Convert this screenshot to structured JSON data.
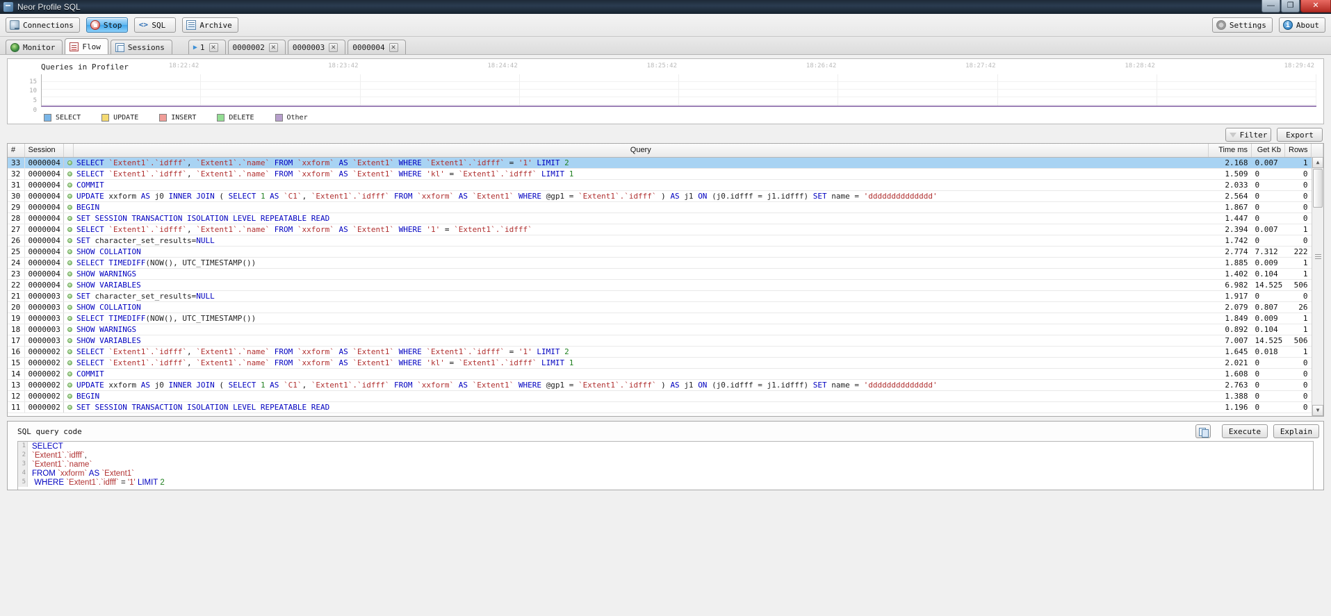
{
  "window": {
    "title": "Neor Profile SQL",
    "minimize": "—",
    "maximize": "❐",
    "close": "✕"
  },
  "toolbar": {
    "connections": "Connections",
    "stop": "Stop",
    "sql": "SQL",
    "archive": "Archive",
    "settings": "Settings",
    "about": "About",
    "icons": {
      "connections": "connections-icon",
      "stop": "stop-icon",
      "sql": "sql-icon",
      "archive": "archive-icon",
      "settings": "gear-icon",
      "about": "info-icon"
    }
  },
  "tabs": {
    "main": [
      {
        "label": "Monitor",
        "icon": "globe-icon",
        "selected": false
      },
      {
        "label": "Flow",
        "icon": "flow-icon",
        "selected": true
      },
      {
        "label": "Sessions",
        "icon": "sessions-icon",
        "selected": false
      }
    ],
    "sessions": [
      {
        "label": "1",
        "close": "✕",
        "play": "▶"
      },
      {
        "label": "0000002",
        "close": "✕"
      },
      {
        "label": "0000003",
        "close": "✕"
      },
      {
        "label": "0000004",
        "close": "✕"
      }
    ]
  },
  "chart_data": {
    "type": "area",
    "title": "Queries in Profiler",
    "xlabel": "",
    "ylabel": "",
    "ylim": [
      0,
      17
    ],
    "yticks": [
      15,
      10,
      5,
      0
    ],
    "grid": true,
    "legend_position": "bottom-left",
    "x": [
      "18:22:42",
      "18:23:42",
      "18:24:42",
      "18:25:42",
      "18:26:42",
      "18:27:42",
      "18:28:42",
      "18:29:42"
    ],
    "xticklabels": [
      "18:22:42",
      "18:23:42",
      "18:24:42",
      "18:25:42",
      "18:26:42",
      "18:27:42",
      "18:28:42",
      "18:29:42"
    ],
    "series": [
      {
        "name": "SELECT",
        "color": "#7ab6e8",
        "values": [
          0,
          0,
          0,
          0,
          0,
          0,
          0,
          0
        ]
      },
      {
        "name": "UPDATE",
        "color": "#f4da72",
        "values": [
          0,
          0,
          0,
          0,
          0,
          0,
          0,
          0
        ]
      },
      {
        "name": "INSERT",
        "color": "#f09d98",
        "values": [
          0,
          0,
          0,
          0,
          0,
          0,
          0,
          0
        ]
      },
      {
        "name": "DELETE",
        "color": "#93dd93",
        "values": [
          0,
          0,
          0,
          0,
          0,
          0,
          0,
          0
        ]
      },
      {
        "name": "Other",
        "color": "#b79fcc",
        "values": [
          0,
          0,
          0,
          0,
          0,
          0,
          0,
          0
        ]
      }
    ]
  },
  "filterbar": {
    "filter": "Filter",
    "export": "Export"
  },
  "table": {
    "headers": {
      "num": "#",
      "session": "Session",
      "query": "Query",
      "time": "Time ms",
      "kb": "Get Kb",
      "rows": "Rows"
    },
    "rows": [
      {
        "num": "33",
        "session": "0000004",
        "time": "2.168",
        "kb": "0.007",
        "rows": "1",
        "selected": true,
        "query": [
          [
            "kw",
            "SELECT "
          ],
          [
            "id",
            "`Extent1`.`idfff`"
          ],
          [
            "op",
            ", "
          ],
          [
            "id",
            "`Extent1`.`name`"
          ],
          [
            "kw",
            " FROM "
          ],
          [
            "id",
            "`xxform`"
          ],
          [
            "kw",
            " AS "
          ],
          [
            "id",
            "`Extent1`"
          ],
          [
            "kw",
            " WHERE "
          ],
          [
            "id",
            "`Extent1`.`idfff`"
          ],
          [
            "op",
            " = "
          ],
          [
            "id",
            "'1'"
          ],
          [
            "kw",
            " LIMIT "
          ],
          [
            "num",
            "2"
          ]
        ]
      },
      {
        "num": "32",
        "session": "0000004",
        "time": "1.509",
        "kb": "0",
        "rows": "0",
        "query": [
          [
            "kw",
            "SELECT "
          ],
          [
            "id",
            "`Extent1`.`idfff`"
          ],
          [
            "op",
            ", "
          ],
          [
            "id",
            "`Extent1`.`name`"
          ],
          [
            "kw",
            " FROM "
          ],
          [
            "id",
            "`xxform`"
          ],
          [
            "kw",
            " AS "
          ],
          [
            "id",
            "`Extent1`"
          ],
          [
            "kw",
            " WHERE "
          ],
          [
            "id",
            "'kl'"
          ],
          [
            "op",
            " = "
          ],
          [
            "id",
            "`Extent1`.`idfff`"
          ],
          [
            "kw",
            " LIMIT "
          ],
          [
            "num",
            "1"
          ]
        ]
      },
      {
        "num": "31",
        "session": "0000004",
        "time": "2.033",
        "kb": "0",
        "rows": "0",
        "query": [
          [
            "kw",
            "COMMIT"
          ]
        ]
      },
      {
        "num": "30",
        "session": "0000004",
        "time": "2.564",
        "kb": "0",
        "rows": "0",
        "query": [
          [
            "kw",
            "UPDATE "
          ],
          [
            "pl",
            "xxform "
          ],
          [
            "kw",
            "AS "
          ],
          [
            "pl",
            "j0 "
          ],
          [
            "kw",
            "INNER JOIN "
          ],
          [
            "op",
            "( "
          ],
          [
            "kw",
            "SELECT "
          ],
          [
            "num",
            "1"
          ],
          [
            "kw",
            " AS "
          ],
          [
            "id",
            "`C1`"
          ],
          [
            "op",
            ", "
          ],
          [
            "id",
            "`Extent1`.`idfff`"
          ],
          [
            "kw",
            " FROM "
          ],
          [
            "id",
            "`xxform`"
          ],
          [
            "kw",
            " AS "
          ],
          [
            "id",
            "`Extent1`"
          ],
          [
            "kw",
            " WHERE "
          ],
          [
            "pl",
            "@gp1 = "
          ],
          [
            "id",
            "`Extent1`.`idfff`"
          ],
          [
            "op",
            " ) "
          ],
          [
            "kw",
            "AS "
          ],
          [
            "pl",
            "j1 "
          ],
          [
            "kw",
            "ON "
          ],
          [
            "pl",
            "(j0.idfff = j1.idfff) "
          ],
          [
            "kw",
            "SET "
          ],
          [
            "pl",
            "name = "
          ],
          [
            "id",
            "'dddddddddddddd'"
          ]
        ]
      },
      {
        "num": "29",
        "session": "0000004",
        "time": "1.867",
        "kb": "0",
        "rows": "0",
        "query": [
          [
            "kw",
            "BEGIN"
          ]
        ]
      },
      {
        "num": "28",
        "session": "0000004",
        "time": "1.447",
        "kb": "0",
        "rows": "0",
        "query": [
          [
            "kw",
            "SET SESSION TRANSACTION ISOLATION LEVEL REPEATABLE READ"
          ]
        ]
      },
      {
        "num": "27",
        "session": "0000004",
        "time": "2.394",
        "kb": "0.007",
        "rows": "1",
        "query": [
          [
            "kw",
            "SELECT "
          ],
          [
            "id",
            "`Extent1`.`idfff`"
          ],
          [
            "op",
            ", "
          ],
          [
            "id",
            "`Extent1`.`name`"
          ],
          [
            "kw",
            " FROM "
          ],
          [
            "id",
            "`xxform`"
          ],
          [
            "kw",
            " AS "
          ],
          [
            "id",
            "`Extent1`"
          ],
          [
            "kw",
            " WHERE "
          ],
          [
            "id",
            "'1'"
          ],
          [
            "op",
            " = "
          ],
          [
            "id",
            "`Extent1`.`idfff`"
          ]
        ]
      },
      {
        "num": "26",
        "session": "0000004",
        "time": "1.742",
        "kb": "0",
        "rows": "0",
        "query": [
          [
            "kw",
            "SET "
          ],
          [
            "pl",
            "character_set_results="
          ],
          [
            "kw",
            "NULL"
          ]
        ]
      },
      {
        "num": "25",
        "session": "0000004",
        "time": "2.774",
        "kb": "7.312",
        "rows": "222",
        "query": [
          [
            "kw",
            "SHOW COLLATION"
          ]
        ]
      },
      {
        "num": "24",
        "session": "0000004",
        "time": "1.885",
        "kb": "0.009",
        "rows": "1",
        "query": [
          [
            "kw",
            "SELECT TIMEDIFF"
          ],
          [
            "pl",
            "(NOW(), UTC_TIMESTAMP())"
          ]
        ]
      },
      {
        "num": "23",
        "session": "0000004",
        "time": "1.402",
        "kb": "0.104",
        "rows": "1",
        "query": [
          [
            "kw",
            "SHOW WARNINGS"
          ]
        ]
      },
      {
        "num": "22",
        "session": "0000004",
        "time": "6.982",
        "kb": "14.525",
        "rows": "506",
        "query": [
          [
            "kw",
            "SHOW VARIABLES"
          ]
        ]
      },
      {
        "num": "21",
        "session": "0000003",
        "time": "1.917",
        "kb": "0",
        "rows": "0",
        "query": [
          [
            "kw",
            "SET "
          ],
          [
            "pl",
            "character_set_results="
          ],
          [
            "kw",
            "NULL"
          ]
        ]
      },
      {
        "num": "20",
        "session": "0000003",
        "time": "2.079",
        "kb": "0.807",
        "rows": "26",
        "query": [
          [
            "kw",
            "SHOW COLLATION"
          ]
        ]
      },
      {
        "num": "19",
        "session": "0000003",
        "time": "1.849",
        "kb": "0.009",
        "rows": "1",
        "query": [
          [
            "kw",
            "SELECT TIMEDIFF"
          ],
          [
            "pl",
            "(NOW(), UTC_TIMESTAMP())"
          ]
        ]
      },
      {
        "num": "18",
        "session": "0000003",
        "time": "0.892",
        "kb": "0.104",
        "rows": "1",
        "query": [
          [
            "kw",
            "SHOW WARNINGS"
          ]
        ]
      },
      {
        "num": "17",
        "session": "0000003",
        "time": "7.007",
        "kb": "14.525",
        "rows": "506",
        "query": [
          [
            "kw",
            "SHOW VARIABLES"
          ]
        ]
      },
      {
        "num": "16",
        "session": "0000002",
        "time": "1.645",
        "kb": "0.018",
        "rows": "1",
        "query": [
          [
            "kw",
            "SELECT "
          ],
          [
            "id",
            "`Extent1`.`idfff`"
          ],
          [
            "op",
            ", "
          ],
          [
            "id",
            "`Extent1`.`name`"
          ],
          [
            "kw",
            " FROM "
          ],
          [
            "id",
            "`xxform`"
          ],
          [
            "kw",
            " AS "
          ],
          [
            "id",
            "`Extent1`"
          ],
          [
            "kw",
            " WHERE "
          ],
          [
            "id",
            "`Extent1`.`idfff`"
          ],
          [
            "op",
            " = "
          ],
          [
            "id",
            "'1'"
          ],
          [
            "kw",
            " LIMIT "
          ],
          [
            "num",
            "2"
          ]
        ]
      },
      {
        "num": "15",
        "session": "0000002",
        "time": "2.021",
        "kb": "0",
        "rows": "0",
        "query": [
          [
            "kw",
            "SELECT "
          ],
          [
            "id",
            "`Extent1`.`idfff`"
          ],
          [
            "op",
            ", "
          ],
          [
            "id",
            "`Extent1`.`name`"
          ],
          [
            "kw",
            " FROM "
          ],
          [
            "id",
            "`xxform`"
          ],
          [
            "kw",
            " AS "
          ],
          [
            "id",
            "`Extent1`"
          ],
          [
            "kw",
            " WHERE "
          ],
          [
            "id",
            "'kl'"
          ],
          [
            "op",
            " = "
          ],
          [
            "id",
            "`Extent1`.`idfff`"
          ],
          [
            "kw",
            " LIMIT "
          ],
          [
            "num",
            "1"
          ]
        ]
      },
      {
        "num": "14",
        "session": "0000002",
        "time": "1.608",
        "kb": "0",
        "rows": "0",
        "query": [
          [
            "kw",
            "COMMIT"
          ]
        ]
      },
      {
        "num": "13",
        "session": "0000002",
        "time": "2.763",
        "kb": "0",
        "rows": "0",
        "query": [
          [
            "kw",
            "UPDATE "
          ],
          [
            "pl",
            "xxform "
          ],
          [
            "kw",
            "AS "
          ],
          [
            "pl",
            "j0 "
          ],
          [
            "kw",
            "INNER JOIN "
          ],
          [
            "op",
            "( "
          ],
          [
            "kw",
            "SELECT "
          ],
          [
            "num",
            "1"
          ],
          [
            "kw",
            " AS "
          ],
          [
            "id",
            "`C1`"
          ],
          [
            "op",
            ", "
          ],
          [
            "id",
            "`Extent1`.`idfff`"
          ],
          [
            "kw",
            " FROM "
          ],
          [
            "id",
            "`xxform`"
          ],
          [
            "kw",
            " AS "
          ],
          [
            "id",
            "`Extent1`"
          ],
          [
            "kw",
            " WHERE "
          ],
          [
            "pl",
            "@gp1 = "
          ],
          [
            "id",
            "`Extent1`.`idfff`"
          ],
          [
            "op",
            " ) "
          ],
          [
            "kw",
            "AS "
          ],
          [
            "pl",
            "j1 "
          ],
          [
            "kw",
            "ON "
          ],
          [
            "pl",
            "(j0.idfff = j1.idfff) "
          ],
          [
            "kw",
            "SET "
          ],
          [
            "pl",
            "name = "
          ],
          [
            "id",
            "'dddddddddddddd'"
          ]
        ]
      },
      {
        "num": "12",
        "session": "0000002",
        "time": "1.388",
        "kb": "0",
        "rows": "0",
        "query": [
          [
            "kw",
            "BEGIN"
          ]
        ]
      },
      {
        "num": "11",
        "session": "0000002",
        "time": "1.196",
        "kb": "0",
        "rows": "0",
        "query": [
          [
            "kw",
            "SET SESSION TRANSACTION ISOLATION LEVEL REPEATABLE READ"
          ]
        ]
      }
    ]
  },
  "sql_panel": {
    "label": "SQL query code",
    "copy": "copy-icon",
    "execute": "Execute",
    "explain": "Explain",
    "code_lines": [
      {
        "n": "1",
        "parts": [
          [
            "kw",
            "SELECT"
          ]
        ]
      },
      {
        "n": "2",
        "parts": [
          [
            "id",
            "`Extent1`.`idfff`"
          ],
          [
            "op",
            ","
          ]
        ]
      },
      {
        "n": "3",
        "parts": [
          [
            "id",
            "`Extent1`.`name`"
          ]
        ]
      },
      {
        "n": "4",
        "parts": [
          [
            "kw",
            "FROM "
          ],
          [
            "id",
            "`xxform`"
          ],
          [
            "kw",
            " AS "
          ],
          [
            "id",
            "`Extent1`"
          ]
        ]
      },
      {
        "n": "5",
        "parts": [
          [
            "kw",
            " WHERE "
          ],
          [
            "id",
            "`Extent1`.`idfff`"
          ],
          [
            "op",
            " = "
          ],
          [
            "id",
            "'1'"
          ],
          [
            "kw",
            " LIMIT "
          ],
          [
            "num",
            "2"
          ]
        ]
      }
    ]
  }
}
